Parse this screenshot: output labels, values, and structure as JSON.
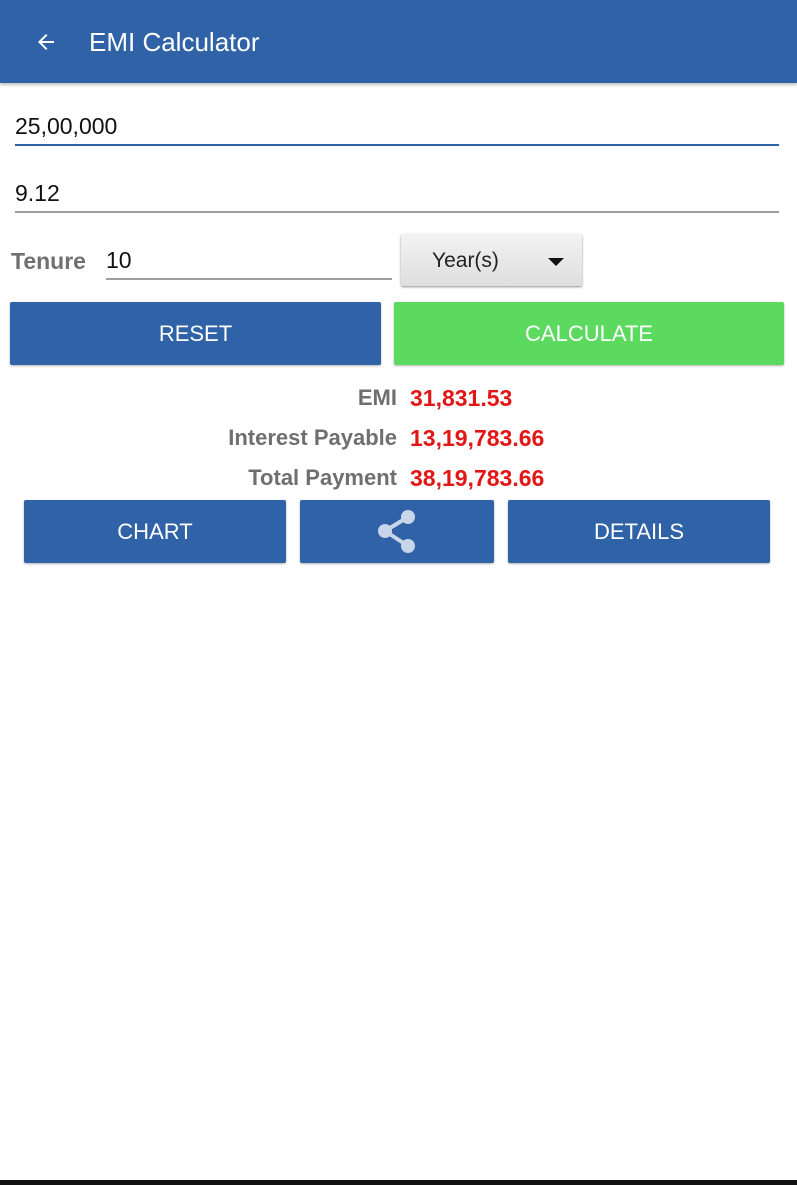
{
  "app_bar": {
    "title": "EMI Calculator",
    "back_icon": "arrow-left-icon",
    "color": "#2f62a6"
  },
  "form": {
    "loan_amount_value": "25,00,000",
    "interest_rate_value": "9.12",
    "tenure_label": "Tenure",
    "tenure_value": "10",
    "tenure_unit_selected": "Year(s)"
  },
  "actions": {
    "reset_label": "RESET",
    "calculate_label": "CALCULATE"
  },
  "results": {
    "emi_label": "EMI",
    "emi_value": "31,831.53",
    "interest_label": "Interest Payable",
    "interest_value": "13,19,783.66",
    "total_label": "Total Payment",
    "total_value": "38,19,783.66",
    "value_color": "#e31515"
  },
  "bottom_actions": {
    "chart_label": "CHART",
    "share_icon": "share-icon",
    "details_label": "DETAILS"
  },
  "colors": {
    "primary": "#2f62a6",
    "accent_green": "#5cd95f"
  }
}
